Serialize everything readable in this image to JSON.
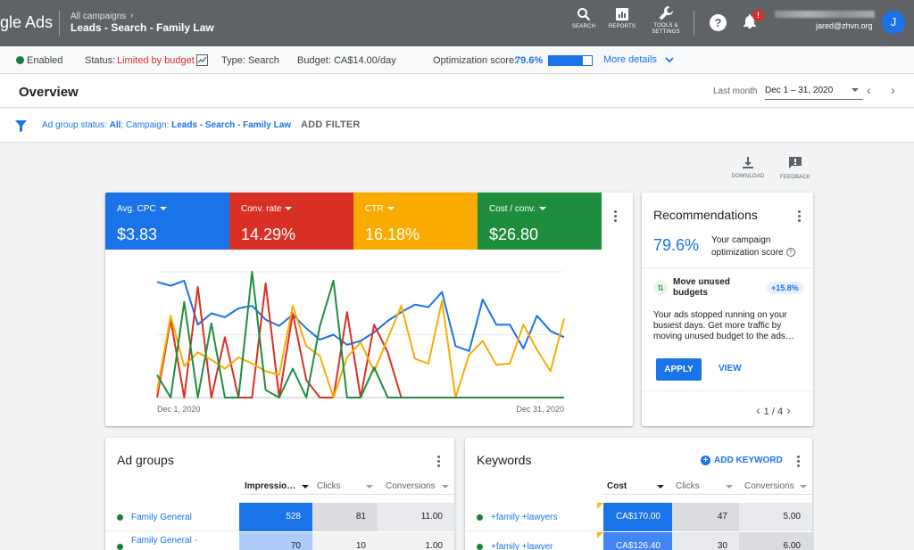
{
  "topbar": {
    "brand": "gle Ads",
    "breadcrumb_parent": "All campaigns",
    "breadcrumb_chevron": "›",
    "campaign_title": "Leads - Search - Family Law",
    "tools": [
      {
        "label": "SEARCH",
        "icon": "search-icon"
      },
      {
        "label": "REPORTS",
        "icon": "reports-icon"
      },
      {
        "label": "TOOLS &\nSETTINGS",
        "icon": "wrench-icon"
      }
    ],
    "help_glyph": "?",
    "notification_badge": "!",
    "account_email": "jared@zhvn.org",
    "avatar_initial": "J"
  },
  "status_bar": {
    "enabled_label": "Enabled",
    "status_label": "Status:",
    "status_value": "Limited by budget",
    "type_text": "Type: Search",
    "budget_text": "Budget: CA$14.00/day",
    "optimization_label": "Optimization score:",
    "optimization_value": "79.6%",
    "optimization_fraction": 0.796,
    "more_details": "More details"
  },
  "overview": {
    "title": "Overview",
    "date_range_label": "Last month",
    "date_range_value": "Dec 1 – 31, 2020",
    "prev": "‹",
    "next": "›"
  },
  "filter_bar": {
    "prefix": "Ad group status: ",
    "status_value": "All",
    "middle": "; Campaign: ",
    "campaign_value": "Leads - Search - Family Law",
    "add_filter": "ADD FILTER"
  },
  "toolbar": {
    "download": "DOWNLOAD",
    "feedback": "FEEDBACK"
  },
  "metrics": [
    {
      "name": "Avg. CPC",
      "value": "$3.83",
      "color": "#1a73e8"
    },
    {
      "name": "Conv. rate",
      "value": "14.29%",
      "color": "#d93025"
    },
    {
      "name": "CTR",
      "value": "16.18%",
      "color": "#f9ab00"
    },
    {
      "name": "Cost / conv.",
      "value": "$26.80",
      "color": "#1e8e3e"
    }
  ],
  "chart_data": {
    "type": "line",
    "x_start_label": "Dec 1, 2020",
    "x_end_label": "Dec 31, 2020",
    "x": [
      1,
      2,
      3,
      4,
      5,
      6,
      7,
      8,
      9,
      10,
      11,
      12,
      13,
      14,
      15,
      16,
      17,
      18,
      19,
      20,
      21,
      22,
      23,
      24,
      25,
      26,
      27,
      28,
      29,
      30,
      31
    ],
    "series": [
      {
        "name": "Avg. CPC",
        "color": "#1a73e8",
        "values": [
          0.92,
          0.89,
          0.93,
          0.58,
          0.67,
          0.64,
          0.71,
          0.73,
          0.62,
          0.57,
          0.66,
          0.55,
          0.46,
          0.5,
          0.42,
          0.45,
          0.52,
          0.61,
          0.68,
          0.74,
          0.72,
          0.84,
          0.41,
          0.37,
          0.78,
          0.58,
          0.58,
          0.39,
          0.65,
          0.53,
          0.48
        ]
      },
      {
        "name": "Conv. rate",
        "color": "#d93025",
        "values": [
          0.0,
          0.62,
          0.0,
          0.88,
          0.0,
          0.48,
          0.0,
          0.0,
          0.91,
          0.0,
          0.67,
          0.14,
          0.0,
          0.0,
          0.68,
          0.0,
          0.58,
          0.36,
          0.0,
          0.0,
          0.0,
          0.0,
          0.0,
          0.0,
          0.0,
          0.0,
          0.0,
          0.0,
          0.0,
          0.0,
          0.0
        ]
      },
      {
        "name": "CTR",
        "color": "#f9ab00",
        "values": [
          0.05,
          0.65,
          0.25,
          0.36,
          0.3,
          0.23,
          0.32,
          0.27,
          0.21,
          0.18,
          0.73,
          0.41,
          0.33,
          0.0,
          0.32,
          0.44,
          0.21,
          0.47,
          0.73,
          0.31,
          0.27,
          0.77,
          0.0,
          0.34,
          0.45,
          0.26,
          0.27,
          0.58,
          0.38,
          0.21,
          0.63
        ]
      },
      {
        "name": "Cost / conv.",
        "color": "#1e8e3e",
        "values": [
          0.18,
          0.0,
          0.76,
          0.0,
          0.59,
          0.0,
          0.0,
          1.0,
          0.06,
          0.0,
          0.23,
          0.0,
          0.57,
          0.93,
          0.0,
          0.0,
          0.24,
          0.0,
          0.0,
          0.0,
          0.0,
          0.0,
          0.0,
          0.0,
          0.0,
          0.0,
          0.0,
          0.0,
          0.0,
          0.0,
          0.0
        ]
      }
    ]
  },
  "recommendations": {
    "title": "Recommendations",
    "score": "79.6%",
    "score_text_line1": "Your campaign",
    "score_text_line2": "optimization score",
    "info_glyph": "?",
    "item_icon_glyph": "⇅",
    "item_title_line1": "Move unused",
    "item_title_line2": "budgets",
    "item_pct": "+15.8%",
    "item_desc": "Your ads stopped running on your busiest days. Get more traffic by moving unused budget to the ads…",
    "apply": "APPLY",
    "view": "VIEW",
    "pager": "1 / 4",
    "pager_prev": "‹",
    "pager_next": "›"
  },
  "ad_groups": {
    "title": "Ad groups",
    "columns": [
      "Impressio…",
      "Clicks",
      "Conversions"
    ],
    "rows": [
      {
        "name": "Family General",
        "impressions": "528",
        "clicks": "81",
        "conversions": "11.00"
      },
      {
        "name": "Family General -",
        "impressions": "70",
        "clicks": "10",
        "conversions": "1.00"
      }
    ]
  },
  "keywords": {
    "title": "Keywords",
    "add_keyword": "ADD KEYWORD",
    "add_glyph": "+",
    "columns": [
      "Cost",
      "Clicks",
      "Conversions"
    ],
    "rows": [
      {
        "name": "+family +lawyers",
        "cost": "CA$170.00",
        "clicks": "47",
        "conversions": "5.00"
      },
      {
        "name": "+family +lawyer",
        "cost": "CA$126.40",
        "clicks": "30",
        "conversions": "6.00"
      }
    ]
  }
}
